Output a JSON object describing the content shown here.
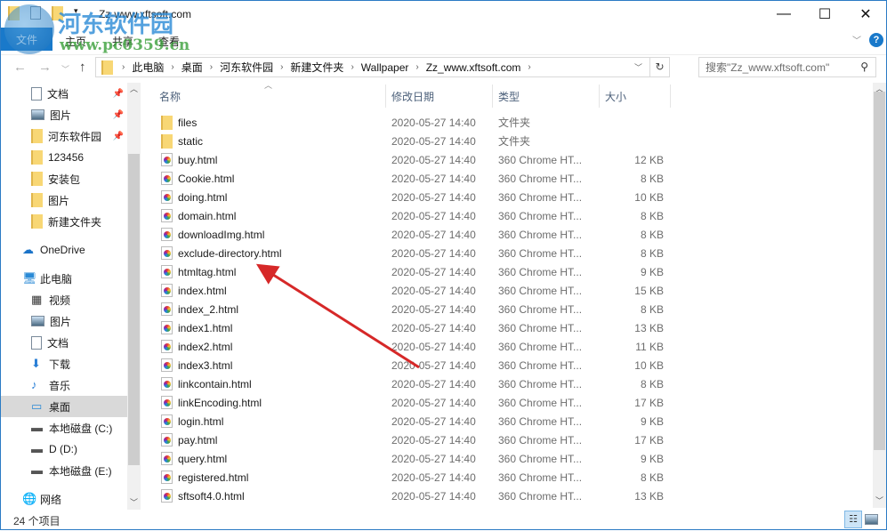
{
  "window": {
    "title": "Zz-www.xftsoft.com",
    "minimize": "—",
    "maximize": "☐",
    "close": "✕"
  },
  "watermark": {
    "line1": "河东软件园",
    "line2": "www.pc0359.cn"
  },
  "ribbon": {
    "file": "文件",
    "tabs": [
      "主页",
      "共享",
      "查看"
    ],
    "collapse": "﹀",
    "help": "?"
  },
  "nav_buttons": {
    "back": "←",
    "forward": "→",
    "recent": "﹀",
    "up": "↑",
    "dropdown": "﹀",
    "refresh": "↻"
  },
  "address": {
    "crumbs": [
      "此电脑",
      "桌面",
      "河东软件园",
      "新建文件夹",
      "Wallpaper",
      "Zz_www.xftsoft.com"
    ]
  },
  "search": {
    "placeholder": "搜索\"Zz_www.xftsoft.com\""
  },
  "sidebar": {
    "items": [
      {
        "label": "文档",
        "icon": "doc",
        "pinned": true
      },
      {
        "label": "图片",
        "icon": "pic",
        "pinned": true
      },
      {
        "label": "河东软件园",
        "icon": "folder",
        "pinned": true
      },
      {
        "label": "123456",
        "icon": "folder"
      },
      {
        "label": "安装包",
        "icon": "folder"
      },
      {
        "label": "图片",
        "icon": "folder"
      },
      {
        "label": "新建文件夹",
        "icon": "folder"
      },
      {
        "label": "OneDrive",
        "icon": "cloud",
        "top": true
      },
      {
        "label": "此电脑",
        "icon": "pc",
        "top": true
      },
      {
        "label": "视频",
        "icon": "video"
      },
      {
        "label": "图片",
        "icon": "pic"
      },
      {
        "label": "文档",
        "icon": "doc"
      },
      {
        "label": "下载",
        "icon": "download"
      },
      {
        "label": "音乐",
        "icon": "music"
      },
      {
        "label": "桌面",
        "icon": "desktop",
        "selected": true
      },
      {
        "label": "本地磁盘 (C:)",
        "icon": "drive"
      },
      {
        "label": "D (D:)",
        "icon": "drive"
      },
      {
        "label": "本地磁盘 (E:)",
        "icon": "drive"
      },
      {
        "label": "网络",
        "icon": "network",
        "top": true
      }
    ]
  },
  "columns": {
    "name": "名称",
    "date": "修改日期",
    "type": "类型",
    "size": "大小"
  },
  "files": [
    {
      "name": "files",
      "date": "2020-05-27 14:40",
      "type": "文件夹",
      "size": "",
      "folder": true
    },
    {
      "name": "static",
      "date": "2020-05-27 14:40",
      "type": "文件夹",
      "size": "",
      "folder": true
    },
    {
      "name": "buy.html",
      "date": "2020-05-27 14:40",
      "type": "360 Chrome HT...",
      "size": "12 KB"
    },
    {
      "name": "Cookie.html",
      "date": "2020-05-27 14:40",
      "type": "360 Chrome HT...",
      "size": "8 KB"
    },
    {
      "name": "doing.html",
      "date": "2020-05-27 14:40",
      "type": "360 Chrome HT...",
      "size": "10 KB"
    },
    {
      "name": "domain.html",
      "date": "2020-05-27 14:40",
      "type": "360 Chrome HT...",
      "size": "8 KB"
    },
    {
      "name": "downloadImg.html",
      "date": "2020-05-27 14:40",
      "type": "360 Chrome HT...",
      "size": "8 KB"
    },
    {
      "name": "exclude-directory.html",
      "date": "2020-05-27 14:40",
      "type": "360 Chrome HT...",
      "size": "8 KB"
    },
    {
      "name": "htmltag.html",
      "date": "2020-05-27 14:40",
      "type": "360 Chrome HT...",
      "size": "9 KB"
    },
    {
      "name": "index.html",
      "date": "2020-05-27 14:40",
      "type": "360 Chrome HT...",
      "size": "15 KB"
    },
    {
      "name": "index_2.html",
      "date": "2020-05-27 14:40",
      "type": "360 Chrome HT...",
      "size": "8 KB"
    },
    {
      "name": "index1.html",
      "date": "2020-05-27 14:40",
      "type": "360 Chrome HT...",
      "size": "13 KB"
    },
    {
      "name": "index2.html",
      "date": "2020-05-27 14:40",
      "type": "360 Chrome HT...",
      "size": "11 KB"
    },
    {
      "name": "index3.html",
      "date": "2020-05-27 14:40",
      "type": "360 Chrome HT...",
      "size": "10 KB"
    },
    {
      "name": "linkcontain.html",
      "date": "2020-05-27 14:40",
      "type": "360 Chrome HT...",
      "size": "8 KB"
    },
    {
      "name": "linkEncoding.html",
      "date": "2020-05-27 14:40",
      "type": "360 Chrome HT...",
      "size": "17 KB"
    },
    {
      "name": "login.html",
      "date": "2020-05-27 14:40",
      "type": "360 Chrome HT...",
      "size": "9 KB"
    },
    {
      "name": "pay.html",
      "date": "2020-05-27 14:40",
      "type": "360 Chrome HT...",
      "size": "17 KB"
    },
    {
      "name": "query.html",
      "date": "2020-05-27 14:40",
      "type": "360 Chrome HT...",
      "size": "9 KB"
    },
    {
      "name": "registered.html",
      "date": "2020-05-27 14:40",
      "type": "360 Chrome HT...",
      "size": "8 KB"
    },
    {
      "name": "sftsoft4.0.html",
      "date": "2020-05-27 14:40",
      "type": "360 Chrome HT...",
      "size": "13 KB"
    }
  ],
  "status": {
    "count": "24 个项目"
  },
  "colors": {
    "accent": "#1979ca",
    "arrow": "#d62828",
    "selected": "#d9d9d9"
  }
}
